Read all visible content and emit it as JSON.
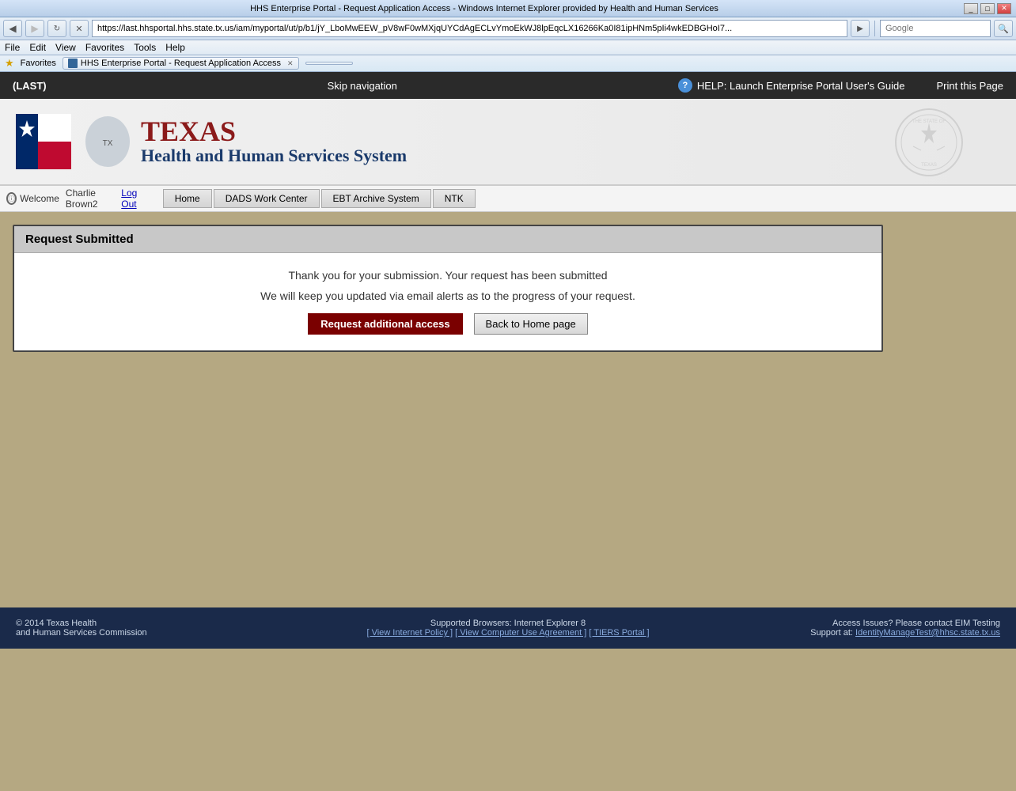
{
  "browser": {
    "titlebar": "HHS Enterprise Portal - Request Application Access - Windows Internet Explorer provided by Health and Human Services",
    "titlebar_controls": [
      "_",
      "□",
      "✕"
    ],
    "address": "https://last.hhsportal.hhs.state.tx.us/iam/myportal/ut/p/b1/jY_LboMwEEW_pV8wF0wMXjqUYCdAgECLvYmoEkWJ8lpEqcLX16266Ka0I81ipHNm5pIi4wkEDBGHoI7...",
    "search_placeholder": "Google",
    "menu": [
      "File",
      "Edit",
      "View",
      "Favorites",
      "Tools",
      "Help"
    ],
    "favorites_label": "Favorites",
    "tab_label": "HHS Enterprise Portal - Request Application Access",
    "tab2_label": ""
  },
  "header": {
    "user": "(LAST)",
    "skip_nav": "Skip navigation",
    "help_icon": "?",
    "help_text": "HELP: Launch Enterprise Portal User's Guide",
    "print_text": "Print this Page"
  },
  "banner": {
    "texas_text": "TEXAS",
    "subtitle": "Health and Human Services System",
    "logo_alt": "Texas HHS Logo"
  },
  "nav": {
    "welcome_prefix": "Welcome",
    "username": "Charlie Brown2",
    "logout_label": "Log Out",
    "tabs": [
      {
        "id": "home",
        "label": "Home",
        "active": false
      },
      {
        "id": "dads",
        "label": "DADS Work Center",
        "active": false
      },
      {
        "id": "ebt",
        "label": "EBT Archive System",
        "active": false
      },
      {
        "id": "ntk",
        "label": "NTK",
        "active": false
      }
    ]
  },
  "content": {
    "box_title": "Request Submitted",
    "message1": "Thank you for your submission. Your request has been submitted",
    "message2": "We will keep you updated via email alerts as to the progress of your request.",
    "btn_request": "Request additional access",
    "btn_home": "Back to Home page"
  },
  "footer": {
    "copyright": "© 2014 Texas Health",
    "copyright2": "and Human Services Commission",
    "browsers_label": "Supported Browsers: Internet Explorer 8",
    "link1": "[ View Internet Policy ]",
    "link2": "[ View Computer Use Agreement ]",
    "link3": "[ TIERS Portal ]",
    "access_label": "Access Issues? Please contact EIM Testing",
    "support_prefix": "Support at:",
    "support_email": "IdentityManageTest@hhsc.state.tx.us"
  }
}
